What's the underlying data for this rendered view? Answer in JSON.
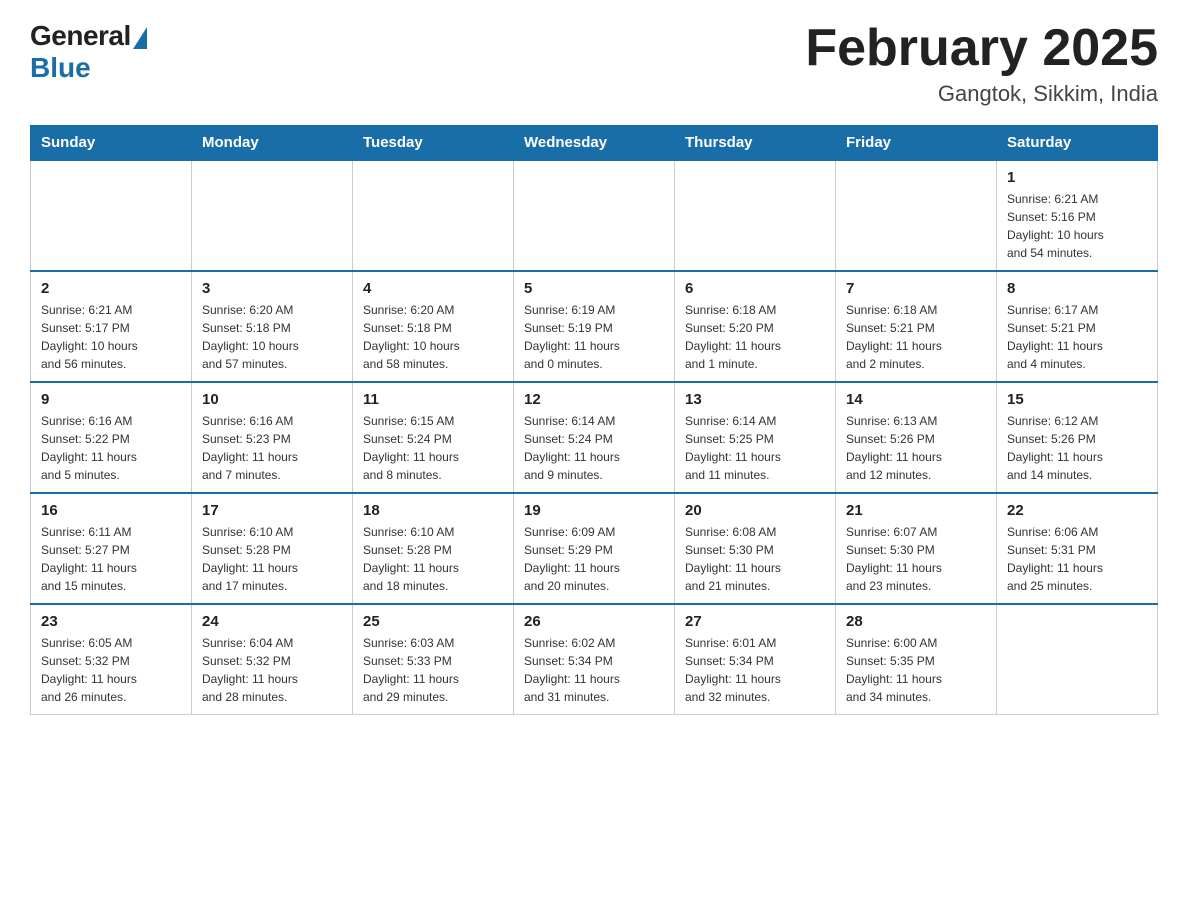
{
  "header": {
    "logo_general": "General",
    "logo_blue": "Blue",
    "month_title": "February 2025",
    "location": "Gangtok, Sikkim, India"
  },
  "days_of_week": [
    "Sunday",
    "Monday",
    "Tuesday",
    "Wednesday",
    "Thursday",
    "Friday",
    "Saturday"
  ],
  "weeks": [
    [
      {
        "day": "",
        "info": ""
      },
      {
        "day": "",
        "info": ""
      },
      {
        "day": "",
        "info": ""
      },
      {
        "day": "",
        "info": ""
      },
      {
        "day": "",
        "info": ""
      },
      {
        "day": "",
        "info": ""
      },
      {
        "day": "1",
        "info": "Sunrise: 6:21 AM\nSunset: 5:16 PM\nDaylight: 10 hours\nand 54 minutes."
      }
    ],
    [
      {
        "day": "2",
        "info": "Sunrise: 6:21 AM\nSunset: 5:17 PM\nDaylight: 10 hours\nand 56 minutes."
      },
      {
        "day": "3",
        "info": "Sunrise: 6:20 AM\nSunset: 5:18 PM\nDaylight: 10 hours\nand 57 minutes."
      },
      {
        "day": "4",
        "info": "Sunrise: 6:20 AM\nSunset: 5:18 PM\nDaylight: 10 hours\nand 58 minutes."
      },
      {
        "day": "5",
        "info": "Sunrise: 6:19 AM\nSunset: 5:19 PM\nDaylight: 11 hours\nand 0 minutes."
      },
      {
        "day": "6",
        "info": "Sunrise: 6:18 AM\nSunset: 5:20 PM\nDaylight: 11 hours\nand 1 minute."
      },
      {
        "day": "7",
        "info": "Sunrise: 6:18 AM\nSunset: 5:21 PM\nDaylight: 11 hours\nand 2 minutes."
      },
      {
        "day": "8",
        "info": "Sunrise: 6:17 AM\nSunset: 5:21 PM\nDaylight: 11 hours\nand 4 minutes."
      }
    ],
    [
      {
        "day": "9",
        "info": "Sunrise: 6:16 AM\nSunset: 5:22 PM\nDaylight: 11 hours\nand 5 minutes."
      },
      {
        "day": "10",
        "info": "Sunrise: 6:16 AM\nSunset: 5:23 PM\nDaylight: 11 hours\nand 7 minutes."
      },
      {
        "day": "11",
        "info": "Sunrise: 6:15 AM\nSunset: 5:24 PM\nDaylight: 11 hours\nand 8 minutes."
      },
      {
        "day": "12",
        "info": "Sunrise: 6:14 AM\nSunset: 5:24 PM\nDaylight: 11 hours\nand 9 minutes."
      },
      {
        "day": "13",
        "info": "Sunrise: 6:14 AM\nSunset: 5:25 PM\nDaylight: 11 hours\nand 11 minutes."
      },
      {
        "day": "14",
        "info": "Sunrise: 6:13 AM\nSunset: 5:26 PM\nDaylight: 11 hours\nand 12 minutes."
      },
      {
        "day": "15",
        "info": "Sunrise: 6:12 AM\nSunset: 5:26 PM\nDaylight: 11 hours\nand 14 minutes."
      }
    ],
    [
      {
        "day": "16",
        "info": "Sunrise: 6:11 AM\nSunset: 5:27 PM\nDaylight: 11 hours\nand 15 minutes."
      },
      {
        "day": "17",
        "info": "Sunrise: 6:10 AM\nSunset: 5:28 PM\nDaylight: 11 hours\nand 17 minutes."
      },
      {
        "day": "18",
        "info": "Sunrise: 6:10 AM\nSunset: 5:28 PM\nDaylight: 11 hours\nand 18 minutes."
      },
      {
        "day": "19",
        "info": "Sunrise: 6:09 AM\nSunset: 5:29 PM\nDaylight: 11 hours\nand 20 minutes."
      },
      {
        "day": "20",
        "info": "Sunrise: 6:08 AM\nSunset: 5:30 PM\nDaylight: 11 hours\nand 21 minutes."
      },
      {
        "day": "21",
        "info": "Sunrise: 6:07 AM\nSunset: 5:30 PM\nDaylight: 11 hours\nand 23 minutes."
      },
      {
        "day": "22",
        "info": "Sunrise: 6:06 AM\nSunset: 5:31 PM\nDaylight: 11 hours\nand 25 minutes."
      }
    ],
    [
      {
        "day": "23",
        "info": "Sunrise: 6:05 AM\nSunset: 5:32 PM\nDaylight: 11 hours\nand 26 minutes."
      },
      {
        "day": "24",
        "info": "Sunrise: 6:04 AM\nSunset: 5:32 PM\nDaylight: 11 hours\nand 28 minutes."
      },
      {
        "day": "25",
        "info": "Sunrise: 6:03 AM\nSunset: 5:33 PM\nDaylight: 11 hours\nand 29 minutes."
      },
      {
        "day": "26",
        "info": "Sunrise: 6:02 AM\nSunset: 5:34 PM\nDaylight: 11 hours\nand 31 minutes."
      },
      {
        "day": "27",
        "info": "Sunrise: 6:01 AM\nSunset: 5:34 PM\nDaylight: 11 hours\nand 32 minutes."
      },
      {
        "day": "28",
        "info": "Sunrise: 6:00 AM\nSunset: 5:35 PM\nDaylight: 11 hours\nand 34 minutes."
      },
      {
        "day": "",
        "info": ""
      }
    ]
  ]
}
